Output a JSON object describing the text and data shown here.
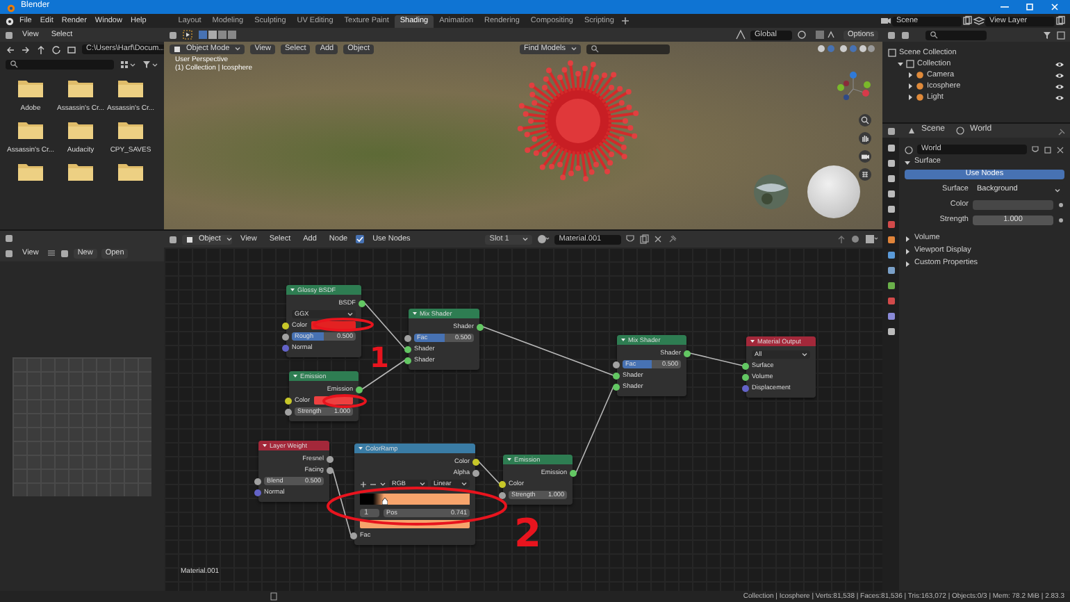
{
  "window": {
    "title": "Blender"
  },
  "menu": [
    "File",
    "Edit",
    "Render",
    "Window",
    "Help"
  ],
  "workspaces": [
    {
      "label": "Layout",
      "selected": false
    },
    {
      "label": "Modeling",
      "selected": false
    },
    {
      "label": "Sculpting",
      "selected": false
    },
    {
      "label": "UV Editing",
      "selected": false
    },
    {
      "label": "Texture Paint",
      "selected": false
    },
    {
      "label": "Shading",
      "selected": true
    },
    {
      "label": "Animation",
      "selected": false
    },
    {
      "label": "Rendering",
      "selected": false
    },
    {
      "label": "Compositing",
      "selected": false
    },
    {
      "label": "Scripting",
      "selected": false
    }
  ],
  "scene": "Scene",
  "view_layer": "View Layer",
  "file_browser": {
    "menu": [
      "View",
      "Select"
    ],
    "path": "C:\\Users\\Harf\\Docum...",
    "folders": [
      {
        "kind": "folder",
        "label": "Adobe"
      },
      {
        "kind": "folder",
        "label": "Assassin's Cr..."
      },
      {
        "kind": "folder",
        "label": "Assassin's Cr..."
      },
      {
        "kind": "folder",
        "label": "Assassin's Cr..."
      },
      {
        "kind": "folder",
        "label": "Audacity"
      },
      {
        "kind": "folder",
        "label": "CPY_SAVES"
      },
      {
        "kind": "folder"
      },
      {
        "kind": "folder"
      },
      {
        "kind": "folder"
      }
    ]
  },
  "image_editor": {
    "menu": [
      "View"
    ],
    "new": "New",
    "open": "Open"
  },
  "viewport": {
    "orientation": "Global",
    "options": "Options",
    "mode": "Object Mode",
    "menu": [
      "View",
      "Select",
      "Add",
      "Object"
    ],
    "find": "Find Models",
    "overlay_lines": [
      "User Perspective",
      "(1) Collection | Icosphere"
    ]
  },
  "node_editor": {
    "object": "Object",
    "menu": [
      "View",
      "Select",
      "Add",
      "Node"
    ],
    "use_nodes": true,
    "use_nodes_label": "Use Nodes",
    "slot": "Slot 1",
    "material": "Material.001",
    "frame_label": "Material.001",
    "nodes": [
      {
        "title": "Glossy BSDF",
        "color": "#2e7d52",
        "rows": [
          {
            "kind": "output",
            "label": "BSDF",
            "socket": {
              "color": "#63c763"
            }
          },
          {
            "kind": "dropdown",
            "value": "GGX"
          },
          {
            "kind": "color",
            "label": "Color",
            "socket": {
              "color": "#c7c729"
            },
            "color": "#e32222"
          },
          {
            "kind": "slider",
            "label": "Rough",
            "value": "0.500",
            "level": 0.5,
            "socket": {
              "color": "#a1a1a1"
            }
          },
          {
            "kind": "input",
            "label": "Normal",
            "socket": {
              "color": "#6363c7"
            }
          }
        ]
      },
      {
        "title": "Mix Shader",
        "color": "#2e7d52",
        "rows": [
          {
            "kind": "output",
            "label": "Shader",
            "socket": {
              "color": "#63c763"
            }
          },
          {
            "kind": "slider",
            "label": "Fac",
            "value": "0.500",
            "level": 0.5,
            "socket": {
              "color": "#a1a1a1"
            }
          },
          {
            "kind": "input",
            "label": "Shader",
            "socket": {
              "color": "#63c763"
            }
          },
          {
            "kind": "input",
            "label": "Shader",
            "socket": {
              "color": "#63c763"
            }
          }
        ]
      },
      {
        "title": "Emission",
        "color": "#2e7d52",
        "rows": [
          {
            "kind": "output",
            "label": "Emission",
            "socket": {
              "color": "#63c763"
            }
          },
          {
            "kind": "color",
            "label": "Color",
            "socket": {
              "color": "#c7c729"
            },
            "color": "#ee4040"
          },
          {
            "kind": "value",
            "label": "Strength",
            "value": "1.000",
            "socket": {
              "color": "#a1a1a1"
            }
          }
        ]
      },
      {
        "title": "Mix Shader",
        "color": "#2e7d52",
        "rows": [
          {
            "kind": "output",
            "label": "Shader",
            "socket": {
              "color": "#63c763"
            }
          },
          {
            "kind": "slider",
            "label": "Fac",
            "value": "0.500",
            "level": 0.5,
            "socket": {
              "color": "#a1a1a1"
            }
          },
          {
            "kind": "input",
            "label": "Shader",
            "socket": {
              "color": "#63c763"
            }
          },
          {
            "kind": "input",
            "label": "Shader",
            "socket": {
              "color": "#63c763"
            }
          }
        ]
      },
      {
        "title": "Material Output",
        "color": "#a3283a",
        "rows": [
          {
            "kind": "dropdown",
            "value": "All"
          },
          {
            "kind": "input",
            "label": "Surface",
            "socket": {
              "color": "#63c763"
            }
          },
          {
            "kind": "input",
            "label": "Volume",
            "socket": {
              "color": "#63c763"
            }
          },
          {
            "kind": "input",
            "label": "Displacement",
            "socket": {
              "color": "#6363c7"
            }
          }
        ]
      },
      {
        "title": "Layer Weight",
        "color": "#a3283a",
        "rows": [
          {
            "kind": "output",
            "label": "Fresnel",
            "socket": {
              "color": "#a1a1a1"
            }
          },
          {
            "kind": "output",
            "label": "Facing",
            "socket": {
              "color": "#a1a1a1"
            }
          },
          {
            "kind": "value",
            "label": "Blend",
            "value": "0.500",
            "socket": {
              "color": "#a1a1a1"
            }
          },
          {
            "kind": "input",
            "label": "Normal",
            "socket": {
              "color": "#6363c7"
            }
          }
        ]
      },
      {
        "title": "ColorRamp",
        "color": "#3a7ca5",
        "rows": [
          {
            "kind": "output",
            "label": "Color",
            "socket": {
              "color": "#c7c729"
            }
          },
          {
            "kind": "output",
            "label": "Alpha",
            "socket": {
              "color": "#a1a1a1"
            }
          },
          {
            "kind": "ramp_controls",
            "mode": "RGB",
            "interpolation": "Linear"
          },
          {
            "kind": "ramp"
          },
          {
            "kind": "ramp_pos",
            "index": "1",
            "label": "Pos",
            "value": "0.741"
          },
          {
            "kind": "ramp_color",
            "color": "#f7a46c"
          },
          {
            "kind": "input",
            "label": "Fac",
            "socket": {
              "color": "#a1a1a1"
            }
          }
        ]
      },
      {
        "title": "Emission",
        "color": "#2e7d52",
        "rows": [
          {
            "kind": "output",
            "label": "Emission",
            "socket": {
              "color": "#63c763"
            }
          },
          {
            "kind": "input",
            "label": "Color",
            "socket": {
              "color": "#c7c729"
            }
          },
          {
            "kind": "value",
            "label": "Strength",
            "value": "1.000",
            "socket": {
              "color": "#a1a1a1"
            }
          }
        ]
      }
    ],
    "annotations": [
      {
        "text": "1"
      },
      {
        "text": "2"
      }
    ]
  },
  "outliner": {
    "items": [
      {
        "label": "Scene Collection",
        "children": [
          {
            "label": "Collection",
            "expanded": true,
            "children": [
              {
                "label": "Camera",
                "expanded": false
              },
              {
                "label": "Icosphere",
                "expanded": false
              },
              {
                "label": "Light",
                "expanded": false
              }
            ]
          }
        ]
      }
    ]
  },
  "properties": {
    "tabs": [
      "Scene",
      "World"
    ],
    "world": "World",
    "surface_panel": {
      "label": "Surface",
      "expanded": true
    },
    "use_nodes": "Use Nodes",
    "fields": [
      {
        "kind": "dropdown",
        "label": "Surface",
        "value": "Background"
      },
      {
        "kind": "color",
        "label": "Color"
      },
      {
        "kind": "number",
        "label": "Strength",
        "value": "1.000"
      }
    ],
    "panels": [
      {
        "label": "Volume",
        "expanded": false
      },
      {
        "label": "Viewport Display",
        "expanded": false
      },
      {
        "label": "Custom Properties",
        "expanded": false
      }
    ]
  },
  "status_bar": "Collection | Icosphere | Verts:81,538 | Faces:81,536 | Tris:163,072 | Objects:0/3 | Mem: 78.2 MiB | 2.83.3"
}
